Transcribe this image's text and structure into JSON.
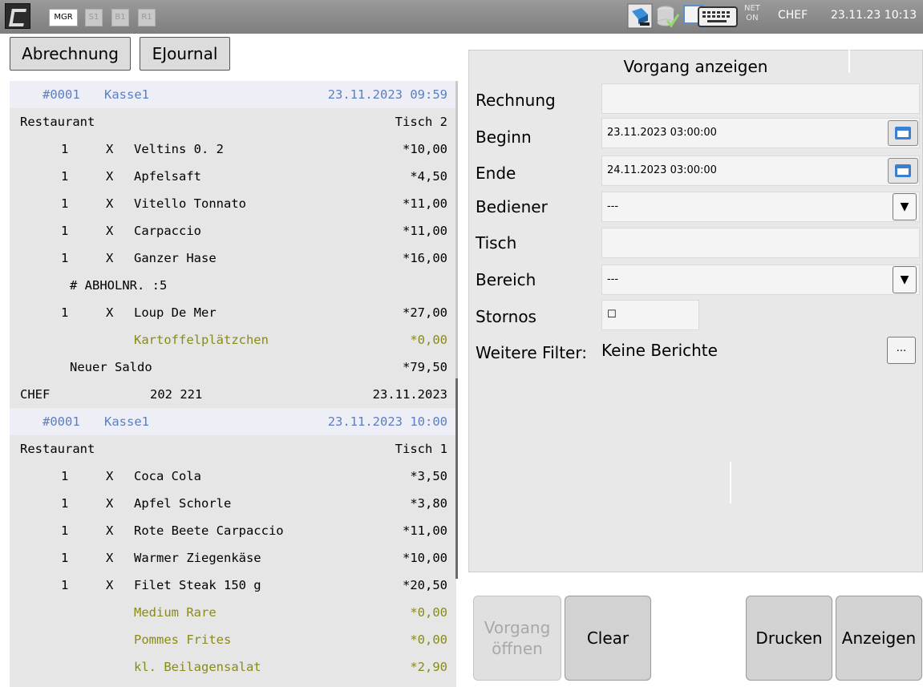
{
  "topbar": {
    "chips": [
      "MGR",
      "S1",
      "B1",
      "R1"
    ],
    "net_label": "NET",
    "net_status": "ON",
    "user": "CHEF",
    "datetime": "23.11.23  10:13",
    "icons": [
      "app-logo-icon",
      "printer-icon",
      "database-check-icon",
      "message-icon",
      "keyboard-icon"
    ]
  },
  "tabs": {
    "abrechnung": "Abrechnung",
    "ejournal": "EJournal"
  },
  "journal": [
    {
      "type": "hdr",
      "c1": "#0001",
      "c2": "Kasse1",
      "c3": "23.11.2023 09:59"
    },
    {
      "type": "area",
      "c1": "Restaurant",
      "c3": "Tisch 2"
    },
    {
      "type": "item",
      "qty": "1",
      "x": "X",
      "name": "Veltins 0. 2",
      "price": "*10,00"
    },
    {
      "type": "item",
      "qty": "1",
      "x": "X",
      "name": "Apfelsaft",
      "price": "*4,50"
    },
    {
      "type": "item",
      "qty": "1",
      "x": "X",
      "name": "Vitello Tonnato",
      "price": "*11,00"
    },
    {
      "type": "item",
      "qty": "1",
      "x": "X",
      "name": "Carpaccio",
      "price": "*11,00"
    },
    {
      "type": "item",
      "qty": "1",
      "x": "X",
      "name": "Ganzer Hase",
      "price": "*16,00"
    },
    {
      "type": "note",
      "text": "# ABHOLNR. :5"
    },
    {
      "type": "item",
      "qty": "1",
      "x": "X",
      "name": "Loup De Mer",
      "price": "*27,00"
    },
    {
      "type": "mod",
      "name": "Kartoffelplätzchen",
      "price": "*0,00"
    },
    {
      "type": "saldo",
      "text": "Neuer Saldo",
      "price": "*79,50"
    },
    {
      "type": "footer",
      "c1": "CHEF",
      "c2": "202 221",
      "c3": "23.11.2023"
    },
    {
      "type": "hdr",
      "c1": "#0001",
      "c2": "Kasse1",
      "c3": "23.11.2023 10:00"
    },
    {
      "type": "area",
      "c1": "Restaurant",
      "c3": "Tisch 1"
    },
    {
      "type": "item",
      "qty": "1",
      "x": "X",
      "name": "Coca Cola",
      "price": "*3,50"
    },
    {
      "type": "item",
      "qty": "1",
      "x": "X",
      "name": "Apfel Schorle",
      "price": "*3,80"
    },
    {
      "type": "item",
      "qty": "1",
      "x": "X",
      "name": "Rote Beete Carpaccio",
      "price": "*11,00"
    },
    {
      "type": "item",
      "qty": "1",
      "x": "X",
      "name": "Warmer Ziegenkäse",
      "price": "*10,00"
    },
    {
      "type": "item",
      "qty": "1",
      "x": "X",
      "name": "Filet Steak 150 g",
      "price": "*20,50"
    },
    {
      "type": "mod",
      "name": "Medium Rare",
      "price": "*0,00"
    },
    {
      "type": "mod",
      "name": "Pommes Frites",
      "price": "*0,00"
    },
    {
      "type": "mod",
      "name": "kl. Beilagensalat",
      "price": "*2,90"
    }
  ],
  "panel": {
    "title": "Vorgang anzeigen",
    "rechnung_label": "Rechnung",
    "rechnung_value": "",
    "beginn_label": "Beginn",
    "beginn_value": "23.11.2023 03:00:00",
    "ende_label": "Ende",
    "ende_value": "24.11.2023 03:00:00",
    "bediener_label": "Bediener",
    "bediener_value": "---",
    "tisch_label": "Tisch",
    "tisch_value": "",
    "bereich_label": "Bereich",
    "bereich_value": "---",
    "stornos_label": "Stornos",
    "stornos_value": "☐",
    "filter_label": "Weitere Filter:",
    "filter_value": "Keine Berichte",
    "more_label": "...",
    "dropdown_arrow": "▼"
  },
  "buttons": {
    "vorgang_line1": "Vorgang",
    "vorgang_line2": "öffnen",
    "clear": "Clear",
    "drucken": "Drucken",
    "anzeigen": "Anzeigen"
  },
  "colors": {
    "journal_header": "#5b7fc0",
    "journal_modifier": "#8a8a1a",
    "topbar": "#8a8a8a"
  }
}
